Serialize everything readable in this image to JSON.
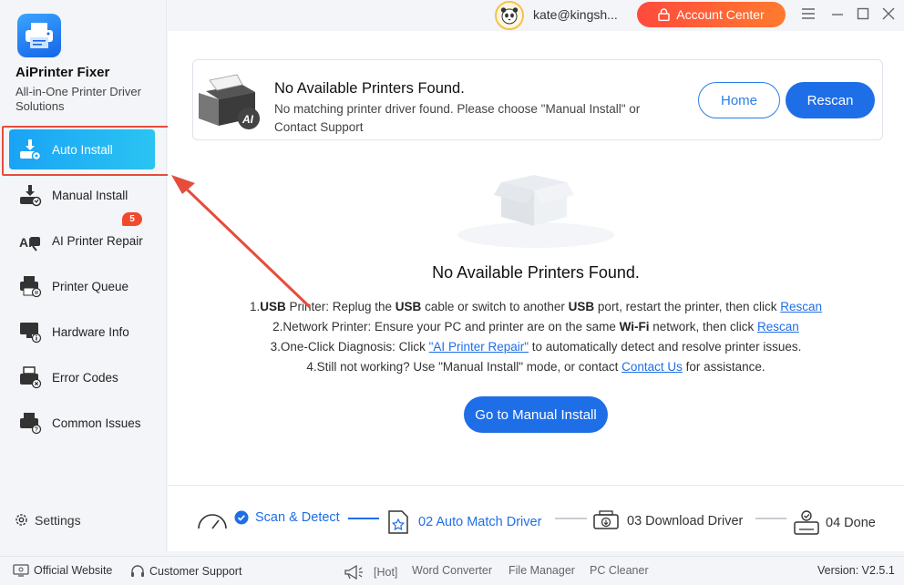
{
  "app": {
    "name": "AiPrinter Fixer",
    "subtitle": "All-in-One Printer Driver Solutions"
  },
  "topbar": {
    "user_email": "kate@kingsh...",
    "account_button": "Account Center"
  },
  "sidebar": {
    "items": [
      {
        "label": "Auto Install",
        "icon": "auto-install-icon"
      },
      {
        "label": "Manual Install",
        "icon": "manual-install-icon"
      },
      {
        "label": "AI Printer Repair",
        "icon": "printer-repair-icon",
        "badge": "5"
      },
      {
        "label": "Printer Queue",
        "icon": "printer-queue-icon"
      },
      {
        "label": "Hardware Info",
        "icon": "hardware-info-icon"
      },
      {
        "label": "Error Codes",
        "icon": "error-codes-icon"
      },
      {
        "label": "Common Issues",
        "icon": "common-issues-icon"
      }
    ],
    "settings_label": "Settings"
  },
  "notice": {
    "title": "No Available Printers Found.",
    "description": "No matching printer driver found. Please choose \"Manual Install\" or Contact Support",
    "home_button": "Home",
    "rescan_button": "Rescan",
    "badge_text": "AI"
  },
  "empty": {
    "title": "No Available Printers Found.",
    "tips": {
      "t1_a": "1.",
      "t1_b": "USB",
      "t1_c": " Printer: Replug the ",
      "t1_d": "USB",
      "t1_e": " cable or switch to another ",
      "t1_f": "USB",
      "t1_g": " port, restart the printer, then click ",
      "t1_link": "Rescan",
      "t2_a": "2.Network Printer: Ensure your PC and printer are on the same ",
      "t2_b": "Wi-Fi",
      "t2_c": " network, then click ",
      "t2_link": "Rescan",
      "t3_a": "3.One-Click Diagnosis: Click ",
      "t3_link": "\"AI Printer Repair\"",
      "t3_b": " to automatically detect and resolve printer issues.",
      "t4_a": "4.Still not working? Use \"Manual Install\" mode, or contact ",
      "t4_link": "Contact Us",
      "t4_b": " for assistance."
    },
    "manual_button": "Go to Manual Install"
  },
  "steps": [
    {
      "label": "Scan & Detect",
      "state": "done"
    },
    {
      "label": "02 Auto Match Driver",
      "state": "active"
    },
    {
      "label": "03 Download Driver",
      "state": "pending"
    },
    {
      "label": "04 Done",
      "state": "pending"
    }
  ],
  "footer": {
    "official_website": "Official Website",
    "customer_support": "Customer Support",
    "hot_tag": "[Hot]",
    "word_converter": "Word Converter",
    "file_manager": "File Manager",
    "pc_cleaner": "PC Cleaner",
    "version": "Version: V2.5.1"
  },
  "colors": {
    "accent": "#1e6ee8",
    "active_gradient_start": "#1aa3f5",
    "active_gradient_end": "#2ac4f2",
    "account_gradient_start": "#ff4a3d",
    "account_gradient_end": "#ff7a2e",
    "highlight_outline": "#e64c3c"
  }
}
